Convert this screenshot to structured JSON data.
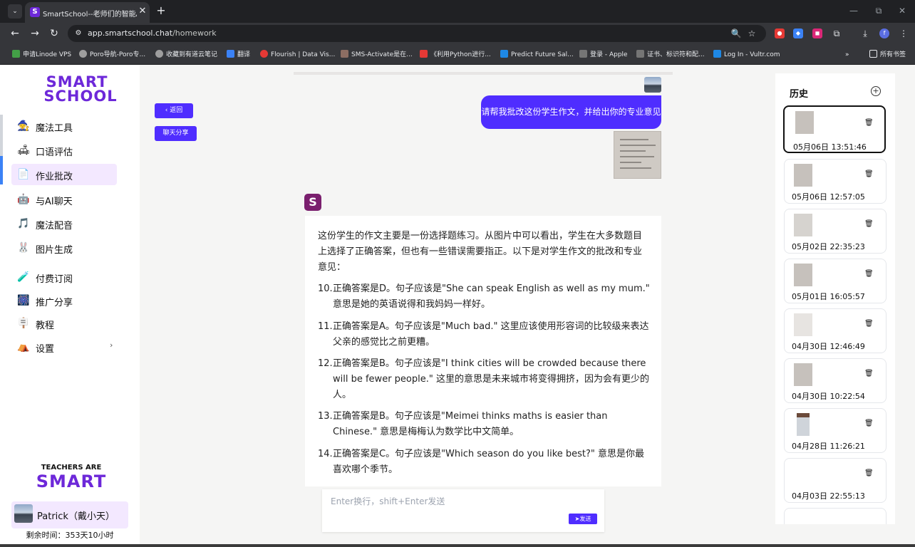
{
  "browser": {
    "tab_title": "SmartSchool--老师们的智能A",
    "url_host": "app.smartschool.chat",
    "url_path": "/homework",
    "bookmarks": [
      "申请Linode VPS",
      "Poro导航-Poro专...",
      "收藏到有道云笔记",
      "翻译",
      "Flourish | Data Vis...",
      "SMS-Activate是在...",
      "《利用Python进行...",
      "Predict Future Sal...",
      "登录 - Apple",
      "证书、标识符和配...",
      "Log In - Vultr.com"
    ],
    "all_bookmarks": "所有书签"
  },
  "sidebar": {
    "logo_line1": "SMART",
    "logo_line2": "SCHOOL",
    "items": [
      {
        "label": "魔法工具",
        "icon": "🧙"
      },
      {
        "label": "口语评估",
        "icon": "🛋"
      },
      {
        "label": "作业批改",
        "icon": "📄"
      },
      {
        "label": "与AI聊天",
        "icon": "🤖"
      },
      {
        "label": "魔法配音",
        "icon": "🎵"
      },
      {
        "label": "图片生成",
        "icon": "🐰"
      },
      {
        "label": "付费订阅",
        "icon": "🧪"
      },
      {
        "label": "推广分享",
        "icon": "🎆"
      },
      {
        "label": "教程",
        "icon": "🪧"
      },
      {
        "label": "设置",
        "icon": "⛺"
      }
    ],
    "settings_arrow": "›",
    "teachers_line1": "TEACHERS ARE",
    "teachers_line2": "SMART",
    "user_name": "Patrick（戴小天）",
    "remaining": "剩余时间：353天10小时"
  },
  "main": {
    "back_label": "‹ 返回",
    "share_label": "聊天分享",
    "user_message": "请帮我批改这份学生作文，并给出你的专业意见",
    "ai_intro": "这份学生的作文主要是一份选择题练习。从图片中可以看出，学生在大多数题目上选择了正确答案，但也有一些错误需要指正。以下是对学生作文的批改和专业意见：",
    "ai_items": [
      {
        "num": "10.",
        "text": "正确答案是D。句子应该是\"She can speak English as well as my mum.\" 意思是她的英语说得和我妈妈一样好。"
      },
      {
        "num": "11.",
        "text": "正确答案是A。句子应该是\"Much bad.\" 这里应该使用形容词的比较级来表达父亲的感觉比之前更糟。"
      },
      {
        "num": "12.",
        "text": "正确答案是B。句子应该是\"I think cities will be crowded because there will be fewer people.\" 这里的意思是未来城市将变得拥挤，因为会有更少的人。"
      },
      {
        "num": "13.",
        "text": "正确答案是B。句子应该是\"Meimei thinks maths is easier than Chinese.\" 意思是梅梅认为数学比中文简单。"
      },
      {
        "num": "14.",
        "text": "正确答案是C。句子应该是\"Which season do you like best?\" 意思是你最喜欢哪个季节。"
      }
    ],
    "input_placeholder": "Enter换行，shift+Enter发送",
    "send_label": "➤发送"
  },
  "history": {
    "title": "历史",
    "add_icon": "⊕",
    "items": [
      {
        "date": "05月06日 13:51:46",
        "selected": true
      },
      {
        "date": "05月06日 12:57:05"
      },
      {
        "date": "05月02日 22:35:23"
      },
      {
        "date": "05月01日 16:05:57"
      },
      {
        "date": "04月30日 12:46:49"
      },
      {
        "date": "04月30日 10:22:54"
      },
      {
        "date": "04月28日 11:26:21"
      },
      {
        "date": "04月03日 22:55:13"
      }
    ]
  },
  "colors": {
    "accent": "#4f2dff",
    "brand": "#6d28d9",
    "active_bg": "#f3e8ff"
  }
}
